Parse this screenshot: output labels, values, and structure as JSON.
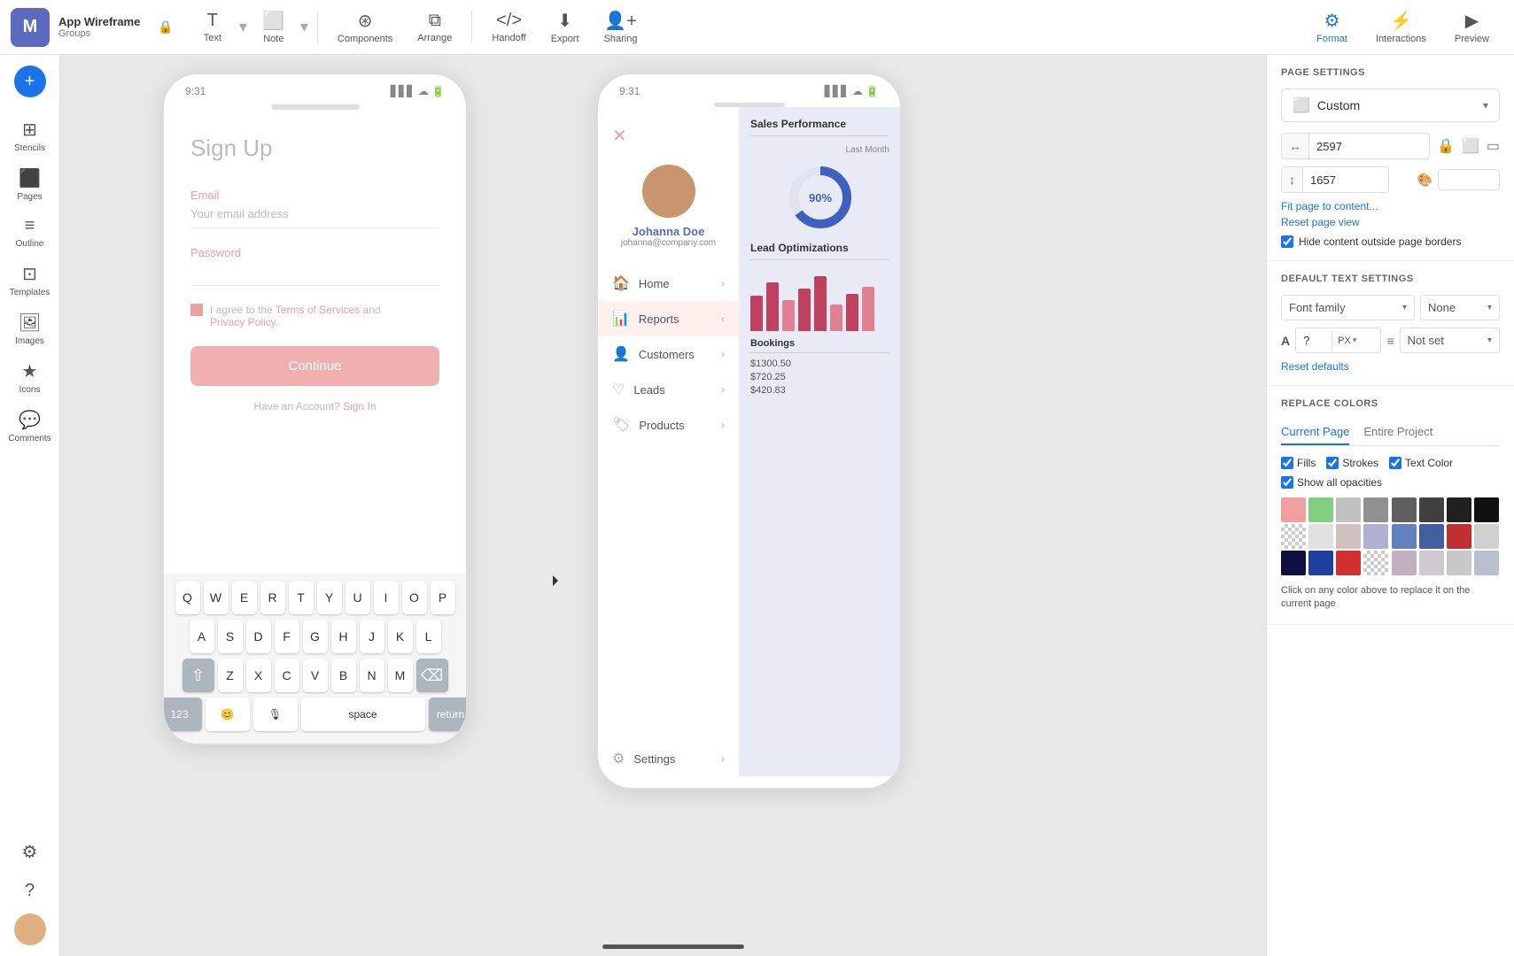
{
  "toolbar": {
    "logo": "M",
    "project_title": "App Wireframe",
    "project_sub": "Groups",
    "lock_icon": "🔒",
    "text_tool": "Text",
    "note_tool": "Note",
    "components_tool": "Components",
    "arrange_tool": "Arrange",
    "handoff_tool": "Handoff",
    "export_tool": "Export",
    "sharing_tool": "Sharing",
    "format_tool": "Format",
    "interactions_tool": "Interactions",
    "preview_tool": "Preview"
  },
  "sidebar": {
    "add_label": "+",
    "items": [
      {
        "id": "stencils",
        "label": "Stencils",
        "icon": "⊞"
      },
      {
        "id": "pages",
        "label": "Pages",
        "icon": "⬜"
      },
      {
        "id": "outline",
        "label": "Outline",
        "icon": "≡"
      },
      {
        "id": "templates",
        "label": "Templates",
        "icon": "⊡"
      },
      {
        "id": "images",
        "label": "Images",
        "icon": "🖼"
      },
      {
        "id": "icons",
        "label": "Icons",
        "icon": "★"
      },
      {
        "id": "comments",
        "label": "Comments",
        "icon": "💬"
      }
    ],
    "settings_icon": "⚙",
    "help_icon": "?"
  },
  "phone1": {
    "time": "9:31",
    "title": "Sign Up",
    "email_label": "Email",
    "email_placeholder": "Your email address",
    "password_label": "Password",
    "terms_text": "I agree to the ",
    "terms_link": "Terms of Services",
    "terms_and": " and",
    "privacy_link": "Privacy Policy.",
    "continue_btn": "Continue",
    "have_account": "Have an Account?",
    "sign_in_link": "Sign In",
    "keyboard_rows": [
      [
        "Q",
        "W",
        "E",
        "R",
        "T",
        "Y",
        "U",
        "I",
        "O",
        "P"
      ],
      [
        "A",
        "S",
        "D",
        "F",
        "G",
        "H",
        "J",
        "K",
        "L"
      ],
      [
        "Z",
        "X",
        "C",
        "V",
        "B",
        "N",
        "M"
      ],
      [
        "123",
        "😊",
        "🎙",
        "space",
        "return"
      ]
    ]
  },
  "phone2": {
    "time": "9:31",
    "user_name": "Johanna Doe",
    "user_email": "johanna@company.com",
    "menu_items": [
      {
        "label": "Home",
        "active": false
      },
      {
        "label": "Reports",
        "active": true
      },
      {
        "label": "Customers",
        "active": false
      },
      {
        "label": "Leads",
        "active": false
      },
      {
        "label": "Products",
        "active": false
      },
      {
        "label": "Settings",
        "active": false
      }
    ],
    "sales_title": "Sales Performance",
    "last_month": "Last Month",
    "donut_percent": "90%",
    "lead_optimizations": "Lead Optimizations",
    "bookings_title": "Bookings",
    "booking_amounts": [
      "$1300.50",
      "$720.25",
      "$420.83"
    ]
  },
  "right_panel": {
    "page_settings_title": "PAGE SETTINGS",
    "custom_label": "Custom",
    "width_value": "2597",
    "height_value": "1657",
    "fit_page_link": "Fit page to content...",
    "reset_view_link": "Reset page view",
    "hide_content_label": "Hide content outside page borders",
    "default_text_title": "DEFAULT TEXT SETTINGS",
    "font_family_label": "Font family",
    "font_weight_label": "None",
    "size_a": "A",
    "size_value": "?",
    "size_unit": "PX",
    "not_set_label": "Not set",
    "reset_defaults_label": "Reset defaults",
    "replace_colors_title": "REPLACE COLORS",
    "tab_current": "Current Page",
    "tab_entire": "Entire Project",
    "fills_label": "Fills",
    "strokes_label": "Strokes",
    "text_color_label": "Text Color",
    "show_opacities_label": "Show all opacities",
    "replace_note": "Click on any color above to replace it on the current page",
    "colors": [
      "#f0a0a0",
      "#80d080",
      "#c0c0c0",
      "#909090",
      "#606060",
      "#404040",
      "#202020",
      "#101010",
      "#f0f0f0",
      "#e0e0e0",
      "#d0c0c0",
      "#b0b0d0",
      "#6080c0",
      "#4060a0",
      "#c03030",
      "#d0d0d0",
      "#101040",
      "#2040a0",
      "#d03030",
      "#f0f0f0",
      "#c0b0c0",
      "#d0c8d0",
      "#c8c8c8",
      "#b8c0d0"
    ]
  }
}
